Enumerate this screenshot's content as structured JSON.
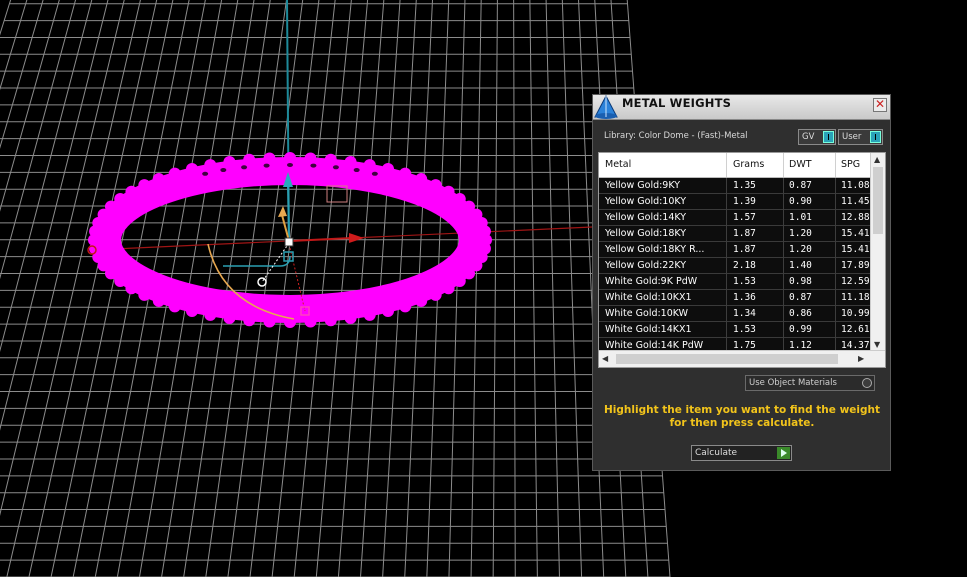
{
  "panel": {
    "title": "METAL WEIGHTS",
    "close_glyph": "✕",
    "library_label": "Library: Color Dome - (Fast)-Metal",
    "toggle_gv": "GV",
    "toggle_user": "User",
    "columns": [
      "Metal",
      "Grams",
      "DWT",
      "SPG"
    ],
    "rows": [
      {
        "metal": "Yellow Gold:9KY",
        "grams": "1.35",
        "dwt": "0.87",
        "spg": "11.08"
      },
      {
        "metal": "Yellow Gold:10KY",
        "grams": "1.39",
        "dwt": "0.90",
        "spg": "11.45"
      },
      {
        "metal": "Yellow Gold:14KY",
        "grams": "1.57",
        "dwt": "1.01",
        "spg": "12.88"
      },
      {
        "metal": "Yellow Gold:18KY",
        "grams": "1.87",
        "dwt": "1.20",
        "spg": "15.41"
      },
      {
        "metal": "Yellow Gold:18KY R...",
        "grams": "1.87",
        "dwt": "1.20",
        "spg": "15.41"
      },
      {
        "metal": "Yellow Gold:22KY",
        "grams": "2.18",
        "dwt": "1.40",
        "spg": "17.89"
      },
      {
        "metal": "White Gold:9K PdW",
        "grams": "1.53",
        "dwt": "0.98",
        "spg": "12.59"
      },
      {
        "metal": "White Gold:10KX1",
        "grams": "1.36",
        "dwt": "0.87",
        "spg": "11.18"
      },
      {
        "metal": "White Gold:10KW",
        "grams": "1.34",
        "dwt": "0.86",
        "spg": "10.99"
      },
      {
        "metal": "White Gold:14KX1",
        "grams": "1.53",
        "dwt": "0.99",
        "spg": "12.61"
      },
      {
        "metal": "White Gold:14K PdW",
        "grams": "1.75",
        "dwt": "1.12",
        "spg": "14.37"
      }
    ],
    "use_object_materials": "Use Object Materials",
    "instructions_line1": "Highlight the item you want to find the weight",
    "instructions_line2": "for then press calculate.",
    "calculate": "Calculate"
  },
  "icons": {
    "app": "rhino-cone-icon",
    "close": "close-icon",
    "scroll_up": "▲",
    "scroll_down": "▼",
    "scroll_left": "◀",
    "scroll_right": "▶"
  },
  "colors": {
    "ring": "#ff00ff",
    "grid": "#8c8c8c",
    "axis_x": "#c01818",
    "axis_z": "#1e8a9a",
    "instruction": "#f2c41b"
  }
}
